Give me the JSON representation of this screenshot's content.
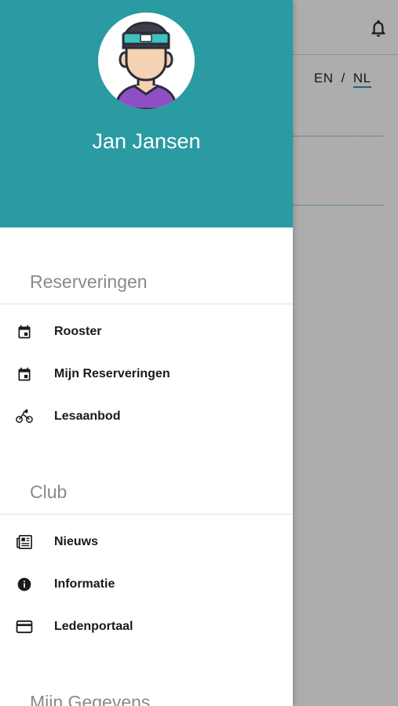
{
  "background": {
    "language": {
      "en": "EN",
      "separator": "/",
      "nl": "NL"
    },
    "bell_icon": "bell-icon"
  },
  "drawer": {
    "user": {
      "name": "Jan Jansen",
      "avatar_icon": "cyclist-avatar"
    },
    "sections": [
      {
        "title": "Reserveringen",
        "items": [
          {
            "label": "Rooster",
            "icon": "calendar-icon"
          },
          {
            "label": "Mijn Reserveringen",
            "icon": "calendar-icon"
          },
          {
            "label": "Lesaanbod",
            "icon": "bicycle-icon"
          }
        ]
      },
      {
        "title": "Club",
        "items": [
          {
            "label": "Nieuws",
            "icon": "newspaper-icon"
          },
          {
            "label": "Informatie",
            "icon": "info-icon"
          },
          {
            "label": "Ledenportaal",
            "icon": "credit-card-icon"
          }
        ]
      },
      {
        "title": "Mijn Gegevens",
        "items": []
      }
    ]
  },
  "colors": {
    "accent": "#2a9aa3",
    "overlay": "rgba(0,0,0,0.32)"
  }
}
